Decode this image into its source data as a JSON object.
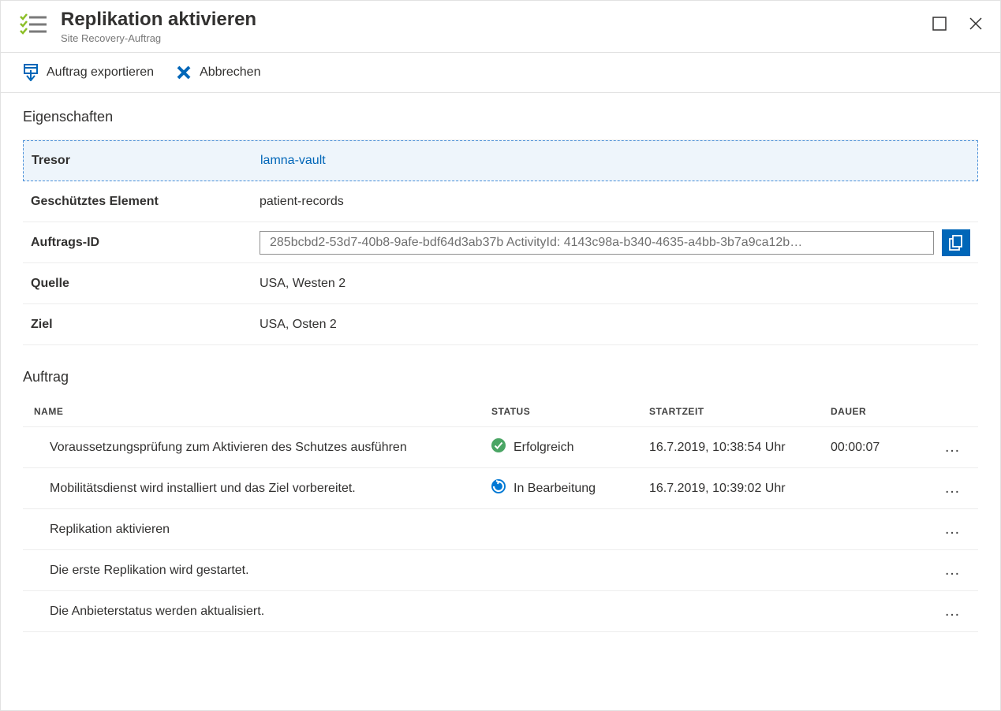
{
  "header": {
    "title": "Replikation aktivieren",
    "subtitle": "Site Recovery-Auftrag"
  },
  "toolbar": {
    "export_label": "Auftrag exportieren",
    "cancel_label": "Abbrechen"
  },
  "properties": {
    "section_title": "Eigenschaften",
    "rows": {
      "tresor_label": "Tresor",
      "tresor_value": "lamna-vault",
      "protected_label": "Geschütztes Element",
      "protected_value": "patient-records",
      "jobid_label": "Auftrags-ID",
      "jobid_value": "285bcbd2-53d7-40b8-9afe-bdf64d3ab37b ActivityId: 4143c98a-b340-4635-a4bb-3b7a9ca12b…",
      "source_label": "Quelle",
      "source_value": "USA, Westen 2",
      "target_label": "Ziel",
      "target_value": "USA, Osten 2"
    }
  },
  "job": {
    "section_title": "Auftrag",
    "columns": {
      "name": "NAME",
      "status": "STATUS",
      "start": "STARTZEIT",
      "duration": "DAUER"
    },
    "rows": [
      {
        "name": "Voraussetzungsprüfung zum Aktivieren des Schutzes ausführen",
        "status": "Erfolgreich",
        "status_type": "success",
        "start": "16.7.2019, 10:38:54 Uhr",
        "duration": "00:00:07"
      },
      {
        "name": "Mobilitätsdienst wird installiert und das Ziel vorbereitet.",
        "status": "In Bearbeitung",
        "status_type": "progress",
        "start": "16.7.2019, 10:39:02 Uhr",
        "duration": ""
      },
      {
        "name": "Replikation aktivieren",
        "status": "",
        "status_type": "",
        "start": "",
        "duration": ""
      },
      {
        "name": "Die erste Replikation wird gestartet.",
        "status": "",
        "status_type": "",
        "start": "",
        "duration": ""
      },
      {
        "name": "Die Anbieterstatus werden aktualisiert.",
        "status": "",
        "status_type": "",
        "start": "",
        "duration": ""
      }
    ]
  }
}
